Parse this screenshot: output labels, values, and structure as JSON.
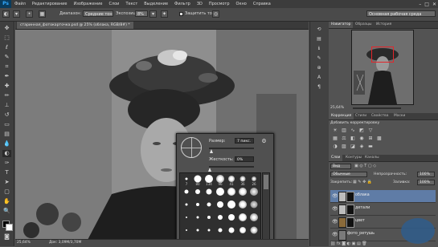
{
  "app": {
    "logo": "Ps",
    "menu": [
      "Файл",
      "Редактирование",
      "Изображение",
      "Слои",
      "Текст",
      "Выделение",
      "Фильтр",
      "3D",
      "Просмотр",
      "Окно",
      "Справка"
    ],
    "window_controls": [
      "–",
      "□",
      "✕"
    ]
  },
  "options_bar": {
    "range_label": "Диапазон:",
    "range_value": "Средние тона",
    "exposure_label": "Экспозиция:",
    "exposure_value": "8%",
    "protect_tones_label": "Защитить тона",
    "workspace": "Основная рабочая среда"
  },
  "document": {
    "tab_title": "старинная_фотокарточка.psd @ 25% (облака, RGB/8#) *",
    "status_zoom": "25,64%",
    "status_doc": "Док: 3,09M/3,70M"
  },
  "brush_picker": {
    "size_label": "Размер:",
    "size_value": "7 пикс.",
    "hardness_label": "Жесткость:",
    "hardness_value": "0%",
    "preset_sizes": [
      "7",
      "80",
      "134",
      "96",
      "41",
      "36",
      "26"
    ]
  },
  "navigator": {
    "tabs": [
      "Навигатор",
      "Образцы",
      "История"
    ],
    "zoom": "25,64%"
  },
  "adjustments": {
    "tabs": [
      "Коррекция",
      "Стили",
      "Свойства",
      "Маски"
    ],
    "title": "Добавить корректировку"
  },
  "layers": {
    "tabs": [
      "Слои",
      "Контуры",
      "Каналы"
    ],
    "kind_label": "Вид",
    "blend_mode": "Обычные",
    "opacity_label": "Непрозрачность:",
    "opacity_value": "100%",
    "lock_label": "Закрепить:",
    "fill_label": "Заливка:",
    "fill_value": "100%",
    "items": [
      {
        "name": "облака",
        "selected": true
      },
      {
        "name": "детали",
        "selected": false
      },
      {
        "name": "цвет",
        "selected": false
      },
      {
        "name": "фото_ретушь",
        "selected": false
      }
    ]
  },
  "icons": {
    "tools": [
      "move-icon",
      "marquee-icon",
      "lasso-icon",
      "quick-select-icon",
      "crop-icon",
      "eyedropper-icon",
      "healing-brush-icon",
      "brush-icon",
      "clone-stamp-icon",
      "history-brush-icon",
      "eraser-icon",
      "gradient-icon",
      "blur-icon",
      "dodge-icon",
      "pen-icon",
      "type-icon",
      "path-select-icon",
      "shape-icon",
      "hand-icon",
      "zoom-icon"
    ]
  }
}
